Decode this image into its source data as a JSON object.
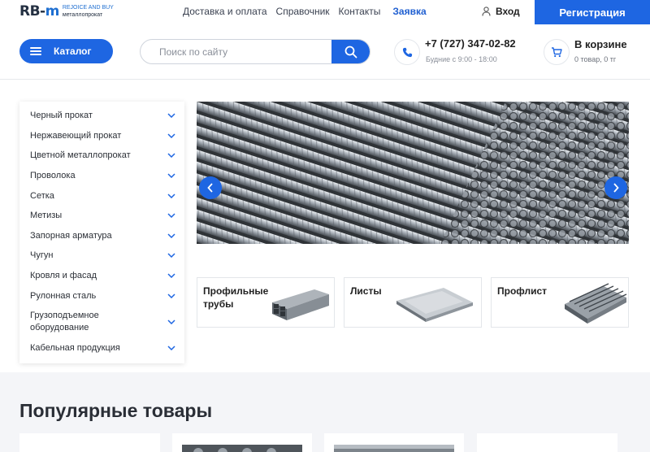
{
  "topbar": {
    "logo_main": "RB-",
    "logo_m": "m",
    "logo_tagline": "REJOICE AND BUY",
    "logo_sub": "металлопрокат",
    "nav": [
      "Доставка и оплата",
      "Справочник",
      "Контакты"
    ],
    "nav_accent": "Заявка",
    "login_label": "Вход",
    "register_label": "Регистрация"
  },
  "header": {
    "catalog_label": "Каталог",
    "search_placeholder": "Поиск по сайту",
    "phone": "+7 (727) 347-02-82",
    "phone_hours": "Будние с 9:00 - 18:00",
    "cart_title": "В корзине",
    "cart_sub": "0 товар, 0 тг"
  },
  "sidebar": {
    "items": [
      {
        "label": "Черный прокат"
      },
      {
        "label": "Нержавеющий прокат"
      },
      {
        "label": "Цветной металлопрокат"
      },
      {
        "label": "Проволока"
      },
      {
        "label": "Сетка"
      },
      {
        "label": "Метизы"
      },
      {
        "label": "Запорная арматура"
      },
      {
        "label": "Чугун"
      },
      {
        "label": "Кровля и фасад"
      },
      {
        "label": "Рулонная сталь"
      },
      {
        "label": "Грузоподъемное оборудование"
      },
      {
        "label": "Кабельная продукция"
      }
    ]
  },
  "categories": [
    {
      "label": "Профильные трубы"
    },
    {
      "label": "Листы"
    },
    {
      "label": "Профлист"
    }
  ],
  "popular": {
    "title": "Популярные товары"
  },
  "colors": {
    "accent": "#1e66e2",
    "text": "#222222",
    "band": "#f4f5f8"
  }
}
